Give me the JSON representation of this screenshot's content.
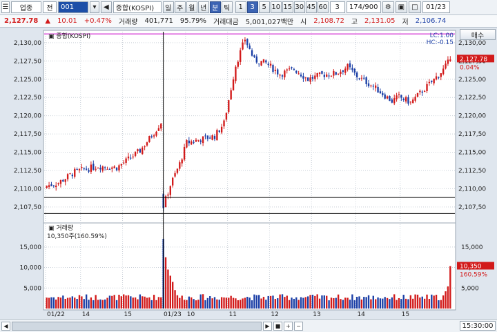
{
  "toolbar": {
    "market": "업종",
    "scope": "전",
    "code": "001",
    "name": "종합(KOSPI)",
    "periods": [
      "일",
      "주",
      "월",
      "년",
      "분",
      "틱"
    ],
    "selected_period": "분",
    "intervals": [
      "1",
      "3",
      "5",
      "10",
      "15",
      "30",
      "45",
      "60"
    ],
    "selected_interval": "3",
    "interval_value": "3",
    "count": "174/900",
    "date": "01/23"
  },
  "info": {
    "price": "2,127.78",
    "change_arrow": "▲",
    "change": "10.01",
    "change_pct": "+0.47%",
    "volume_label": "거래량",
    "volume": "401,771",
    "volume_ratio": "95.79%",
    "amount_label": "거래대금",
    "amount": "5,001,027백만",
    "open_label": "시",
    "open": "2,108.72",
    "high_label": "고",
    "high": "2,131.05",
    "low_label": "저",
    "low": "2,106.74"
  },
  "right_buttons": {
    "trade": "매수"
  },
  "bottom": {
    "time": "15:30:00"
  },
  "chart_data": {
    "type": "candlestick",
    "price_panel": {
      "title": "종합(KOSPI)",
      "ylim": [
        2105.5,
        2131.5
      ],
      "yticks": [
        "2,107,50",
        "2,110,00",
        "2,112,50",
        "2,115,00",
        "2,117,50",
        "2,120,00",
        "2,122,50",
        "2,125,00",
        "2,127,50",
        "2,130,00"
      ],
      "ytick_values": [
        2107.5,
        2110,
        2112.5,
        2115,
        2117.5,
        2120,
        2122.5,
        2125,
        2127.5,
        2130
      ],
      "right_yticks": [
        "2,107,50",
        "2,110,00",
        "2,112,50",
        "2,115,00",
        "2,117,50",
        "2,120,00",
        "2,122,50",
        "2,125,00",
        "2,127,50",
        "2,130,00"
      ],
      "lc_label": "LC:1.00",
      "hc_label": "HC:-0.15",
      "current_price_label": "2,127.78",
      "current_pct_label": "0.04%",
      "upper_line": 2131.2,
      "lower_lines": [
        2108.8,
        2106.6
      ],
      "anchors": [
        [
          0,
          2110.4
        ],
        [
          5,
          2110.8
        ],
        [
          12,
          2112.3
        ],
        [
          22,
          2113.1
        ],
        [
          30,
          2112.9
        ],
        [
          34,
          2113.8
        ],
        [
          40,
          2115.2
        ],
        [
          46,
          2117.7
        ],
        [
          49,
          2119.1
        ],
        [
          50,
          2107.6
        ],
        [
          53,
          2110.5
        ],
        [
          57,
          2113.4
        ],
        [
          60,
          2116.3
        ],
        [
          65,
          2116.7
        ],
        [
          72,
          2117.2
        ],
        [
          76,
          2119.0
        ],
        [
          81,
          2126.9
        ],
        [
          85,
          2130.5
        ],
        [
          89,
          2127.6
        ],
        [
          94,
          2127.2
        ],
        [
          100,
          2125.7
        ],
        [
          106,
          2126.4
        ],
        [
          112,
          2125.0
        ],
        [
          118,
          2125.6
        ],
        [
          124,
          2125.8
        ],
        [
          129,
          2126.7
        ],
        [
          133,
          2125.4
        ],
        [
          140,
          2124.0
        ],
        [
          144,
          2123.0
        ],
        [
          148,
          2122.0
        ],
        [
          151,
          2122.6
        ],
        [
          156,
          2121.8
        ],
        [
          161,
          2123.4
        ],
        [
          165,
          2124.6
        ],
        [
          170,
          2126.3
        ],
        [
          173,
          2127.7
        ]
      ]
    },
    "volume_panel": {
      "title": "거래량",
      "current_label": "10,350주(160.59%)",
      "ylim": [
        0,
        18000
      ],
      "yticks": [
        "5,000",
        "10,000",
        "15,000"
      ],
      "ytick_values": [
        5000,
        10000,
        15000
      ],
      "current_value_label": "10,350",
      "current_pct_label": "160.59%",
      "spikes": [
        [
          50,
          17000
        ],
        [
          51,
          12500
        ],
        [
          52,
          9500
        ],
        [
          53,
          8000
        ],
        [
          54,
          6500
        ],
        [
          55,
          4500
        ],
        [
          173,
          10350
        ],
        [
          172,
          5400
        ],
        [
          171,
          4200
        ],
        [
          170,
          3200
        ]
      ]
    },
    "x_axis": {
      "labels": [
        "01/22",
        "14",
        "15",
        "01/23",
        "10",
        "11",
        "12",
        "13",
        "14",
        "15"
      ],
      "label_index": [
        0,
        15,
        33,
        50,
        60,
        78,
        96,
        114,
        133,
        152
      ]
    },
    "up_color": "#d21a1a",
    "down_color": "#1b3fa6",
    "n_candles": 174
  }
}
